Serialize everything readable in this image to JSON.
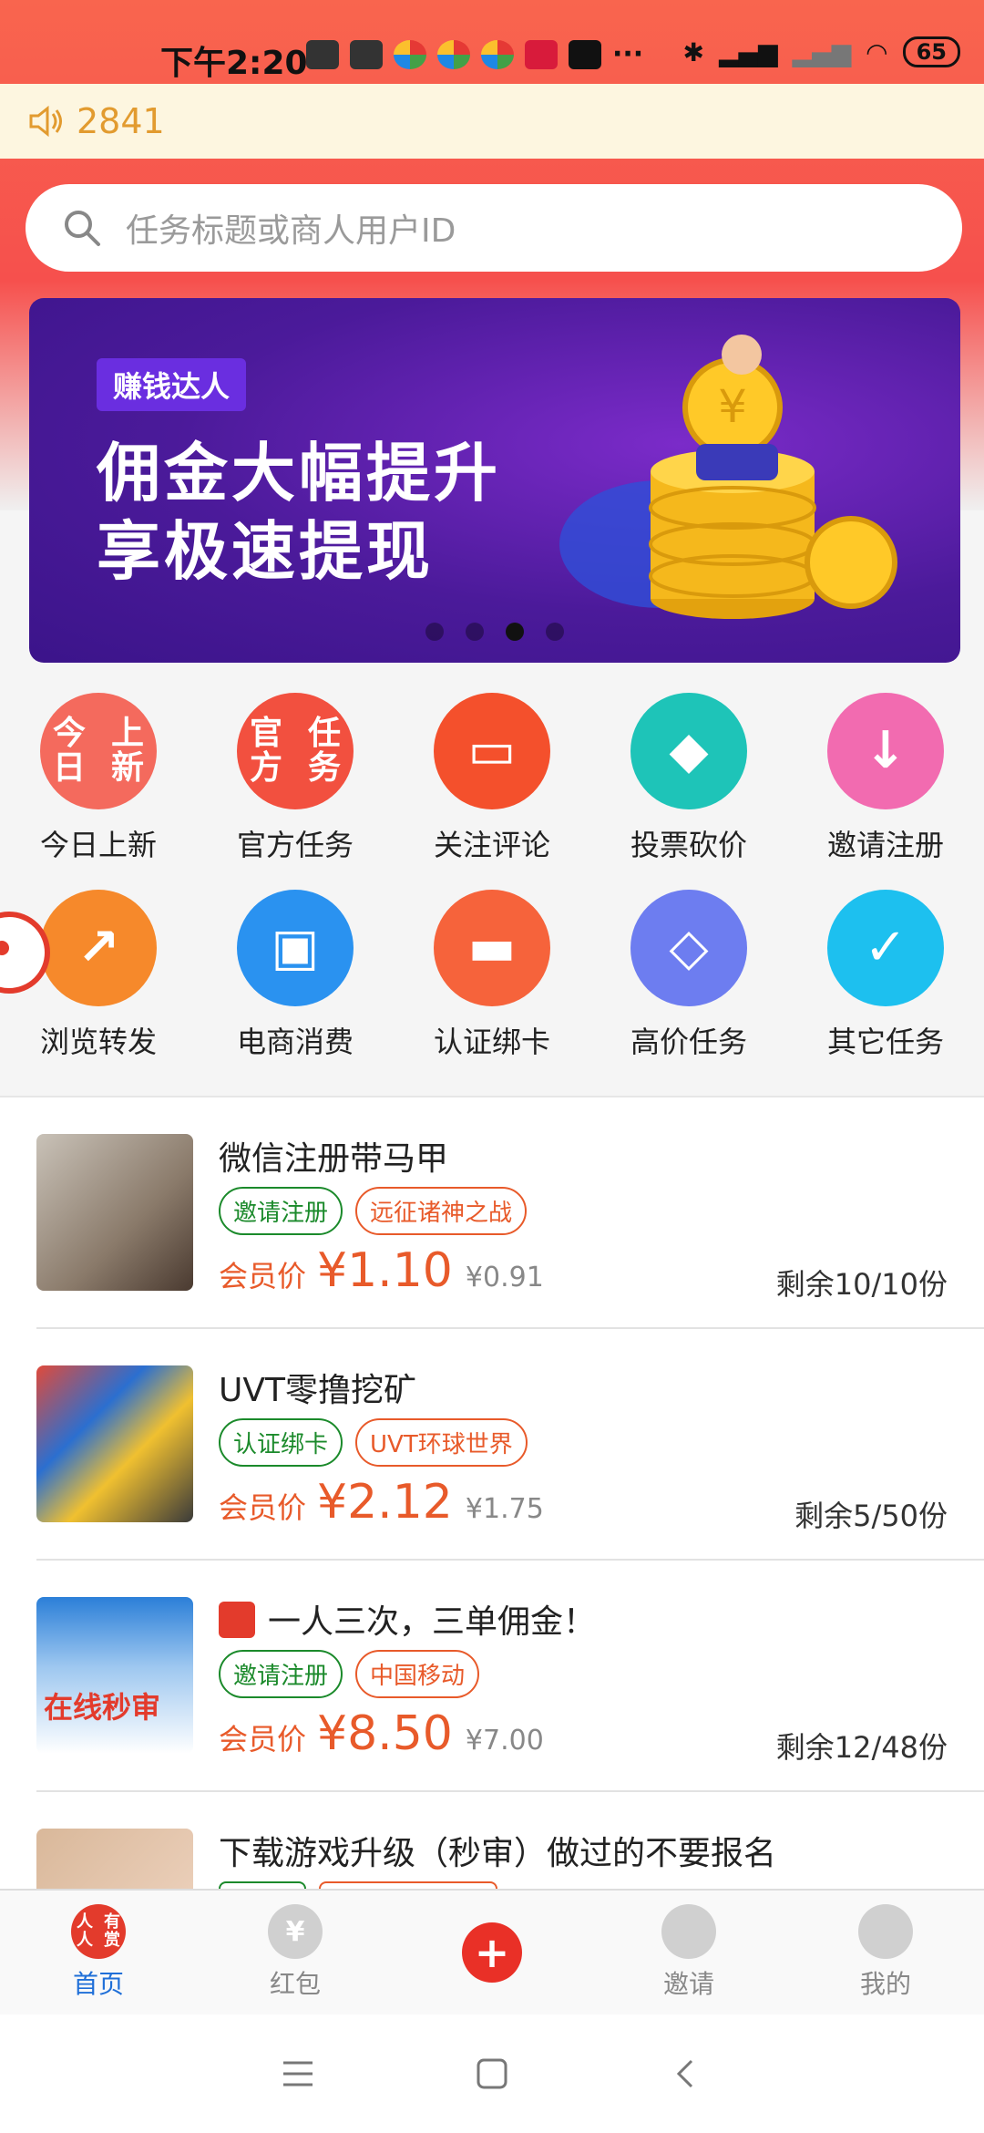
{
  "status_bar": {
    "time": "下午2:20",
    "battery": "65",
    "icons": [
      "message-icon",
      "message-icon",
      "app-icon",
      "app-icon",
      "app-icon",
      "app-icon",
      "tiktok-icon",
      "more-icon",
      "bluetooth-icon",
      "signal-icon",
      "signal-icon",
      "wifi-icon"
    ]
  },
  "notice": {
    "count": "2841",
    "icon": "speaker-icon"
  },
  "search": {
    "placeholder": "任务标题或商人用户ID"
  },
  "banner": {
    "tag": "赚钱达人",
    "line1": "佣金大幅提升",
    "line2": "享极速提现",
    "slides": 4,
    "active_slide": 3
  },
  "categories": [
    {
      "label": "今日上新",
      "icon_text": "今日\n上新",
      "color": "#f46a5d"
    },
    {
      "label": "官方任务",
      "icon_text": "官方\n任务",
      "color": "#f2503f"
    },
    {
      "label": "关注评论",
      "icon_text": "",
      "color": "#f4502c"
    },
    {
      "label": "投票砍价",
      "icon_text": "",
      "color": "#1ec4b8"
    },
    {
      "label": "邀请注册",
      "icon_text": "",
      "color": "#f26bb0"
    },
    {
      "label": "浏览转发",
      "icon_text": "",
      "color": "#f6892b"
    },
    {
      "label": "电商消费",
      "icon_text": "",
      "color": "#2a92f0"
    },
    {
      "label": "认证绑卡",
      "icon_text": "",
      "color": "#f6633b"
    },
    {
      "label": "高价任务",
      "icon_text": "",
      "color": "#6d7df0"
    },
    {
      "label": "其它任务",
      "icon_text": "",
      "color": "#1dc0ef"
    }
  ],
  "tasks": [
    {
      "title": "微信注册带马甲",
      "tags": [
        "邀请注册",
        "远征诸神之战"
      ],
      "member_label": "会员价",
      "price": "¥1.10",
      "orig_price": "¥0.91",
      "remaining": "剩余10/10份",
      "red_packet": false
    },
    {
      "title": "UVT零撸挖矿",
      "tags": [
        "认证绑卡",
        "UVT环球世界"
      ],
      "member_label": "会员价",
      "price": "¥2.12",
      "orig_price": "¥1.75",
      "remaining": "剩余5/50份",
      "red_packet": false
    },
    {
      "title": "一人三次，三单佣金！",
      "tags": [
        "邀请注册",
        "中国移动"
      ],
      "member_label": "会员价",
      "price": "¥8.50",
      "orig_price": "¥7.00",
      "remaining": "剩余12/48份",
      "red_packet": true,
      "thumb_text": "在线秒审"
    },
    {
      "title": "下载游戏升级（秒审）做过的不要报名",
      "tags": [
        "",
        ""
      ],
      "member_label": "",
      "price": "",
      "orig_price": "",
      "remaining": "",
      "red_packet": false
    }
  ],
  "tabbar": [
    {
      "label": "首页",
      "icon": "home-logo-icon",
      "icon_text": "人人\n有赏"
    },
    {
      "label": "红包",
      "icon": "yuan-icon",
      "icon_text": "¥"
    },
    {
      "label": "",
      "icon": "plus-icon",
      "icon_text": "+"
    },
    {
      "label": "邀请",
      "icon": "gift-icon",
      "icon_text": ""
    },
    {
      "label": "我的",
      "icon": "user-icon",
      "icon_text": ""
    }
  ],
  "colors": {
    "accent": "#e85a2a",
    "tab_active": "#1f6fd8",
    "green_tag": "#1b8a2b"
  }
}
